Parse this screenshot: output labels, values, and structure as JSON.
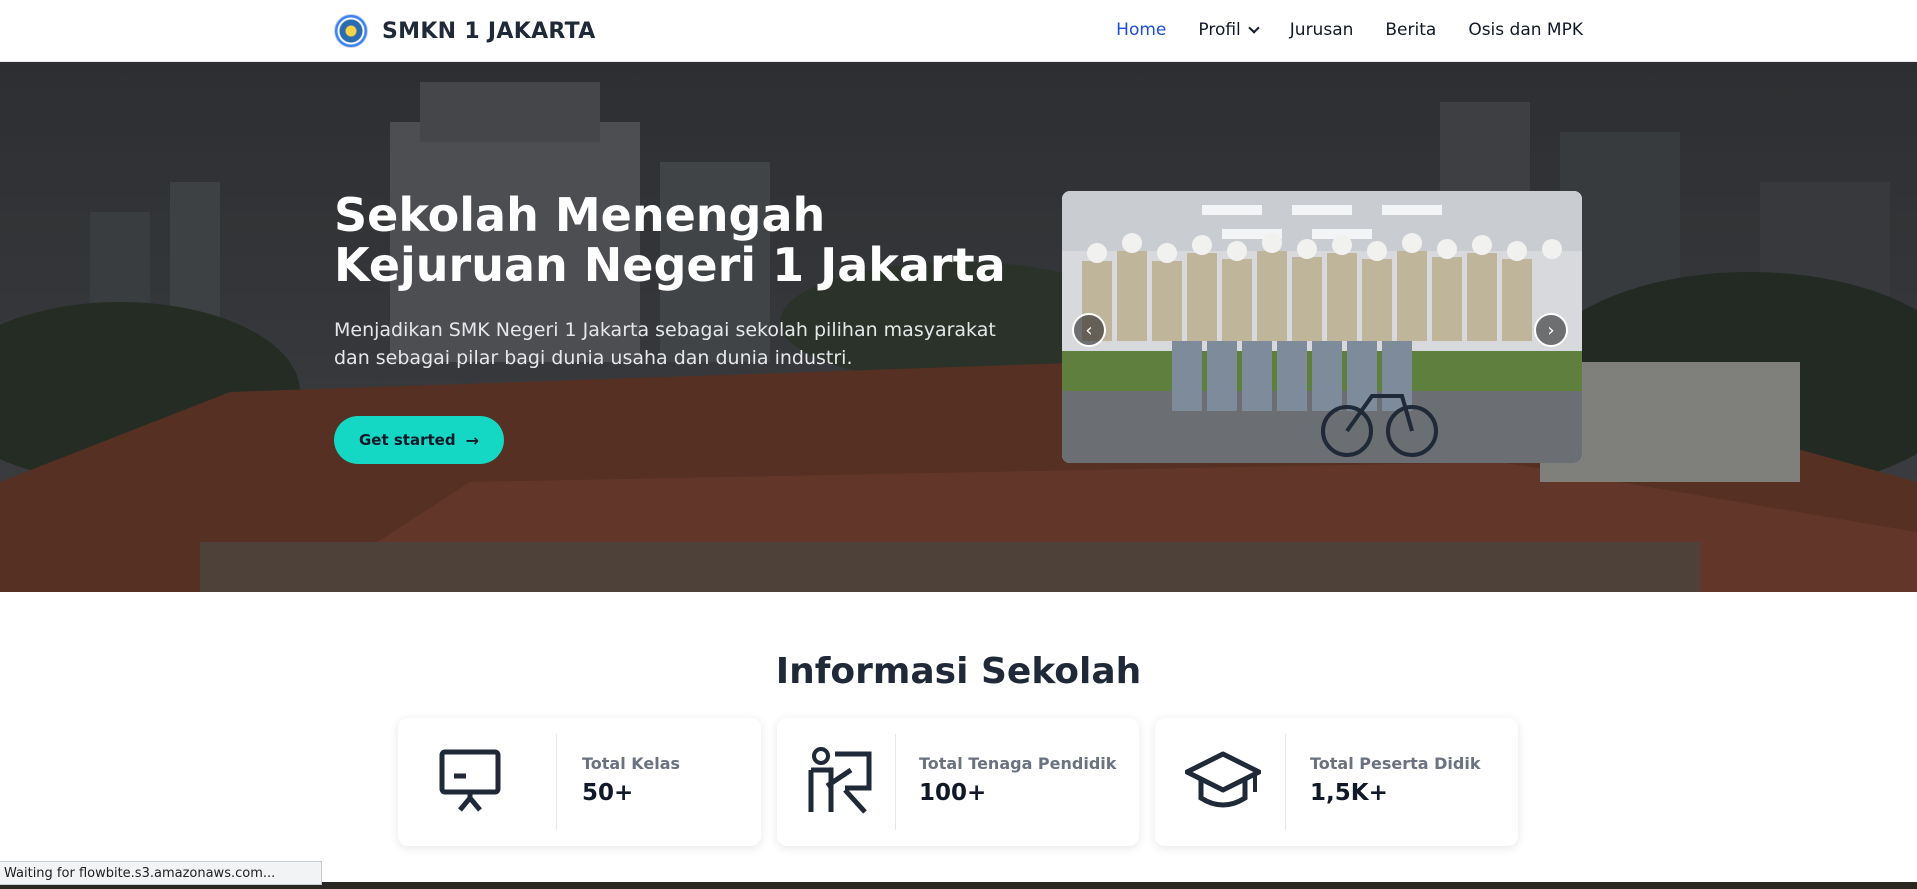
{
  "brand": {
    "name": "SMKN 1 JAKARTA"
  },
  "nav": {
    "items": [
      {
        "label": "Home",
        "active": true
      },
      {
        "label": "Profil",
        "has_dropdown": true
      },
      {
        "label": "Jurusan"
      },
      {
        "label": "Berita"
      },
      {
        "label": "Osis dan MPK"
      }
    ]
  },
  "hero": {
    "title": "Sekolah Menengah Kejuruan Negeri 1 Jakarta",
    "subtitle": "Menjadikan SMK Negeri 1 Jakarta sebagai sekolah pilihan masyarakat dan sebagai pilar bagi dunia usaha dan dunia industri.",
    "cta_label": "Get started",
    "cta_icon": "arrow-right-icon",
    "carousel": {
      "prev_label": "‹",
      "next_label": "›"
    }
  },
  "info": {
    "title": "Informasi Sekolah",
    "cards": [
      {
        "icon": "chalkboard-icon",
        "label": "Total Kelas",
        "value": "50+"
      },
      {
        "icon": "teacher-icon",
        "label": "Total Tenaga Pendidik",
        "value": "100+"
      },
      {
        "icon": "graduation-cap-icon",
        "label": "Total Peserta Didik",
        "value": "1,5K+"
      }
    ]
  },
  "status_bar": {
    "text": "Waiting for flowbite.s3.amazonaws.com..."
  },
  "colors": {
    "accent": "#14d8c3",
    "nav_active": "#1d4ed8",
    "heading": "#1f2937"
  }
}
